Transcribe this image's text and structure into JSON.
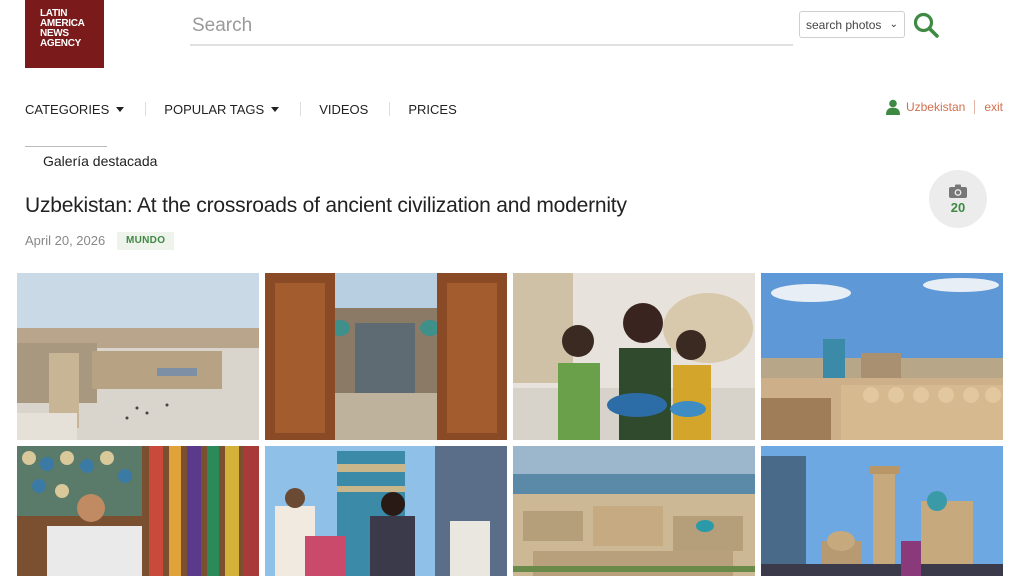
{
  "logo": {
    "lines": [
      "LATIN",
      "AMERICA",
      "NEWS",
      "AGENCY"
    ]
  },
  "search": {
    "placeholder": "Search",
    "select_value": "search photos"
  },
  "nav": {
    "items": [
      {
        "label": "CATEGORIES",
        "dropdown": true
      },
      {
        "label": "POPULAR TAGS",
        "dropdown": true
      },
      {
        "label": "VIDEOS",
        "dropdown": false
      },
      {
        "label": "PRICES",
        "dropdown": false
      }
    ]
  },
  "user": {
    "name": "Uzbekistan",
    "logout": "exit"
  },
  "gallery": {
    "section": "Galería destacada",
    "title": "Uzbekistan: At the crossroads of ancient civilization and modernity",
    "date": "April 20, 2026",
    "tag": "MUNDO",
    "photo_count": "20"
  },
  "photos": [
    {
      "subject": "fortress-square"
    },
    {
      "subject": "madrasa-doorway"
    },
    {
      "subject": "girls-with-plate"
    },
    {
      "subject": "khiva-skyline"
    },
    {
      "subject": "ceramics-shop"
    },
    {
      "subject": "minaret-dancers"
    },
    {
      "subject": "aerial-city"
    },
    {
      "subject": "kalyan-minaret"
    }
  ],
  "colors": {
    "brand": "#7a1a1a",
    "accent_green": "#3e8a43",
    "user_link": "#d2704f"
  }
}
